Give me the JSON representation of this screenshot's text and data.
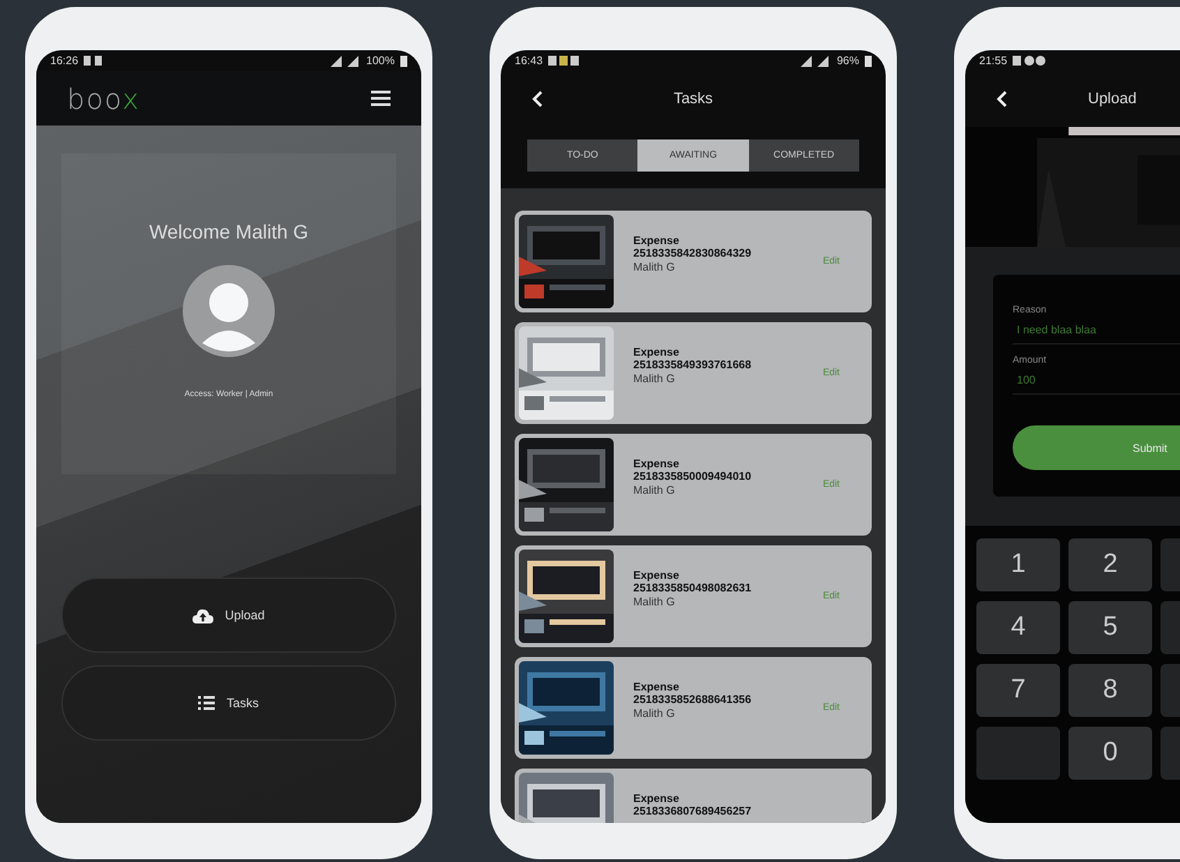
{
  "home": {
    "status_bar": {
      "time": "16:26",
      "battery": "100%"
    },
    "logo": {
      "main": "boo",
      "accent": "x"
    },
    "welcome": "Welcome Malith G",
    "access": "Access: Worker | Admin",
    "buttons": [
      {
        "kind": "upload",
        "label": "Upload"
      },
      {
        "kind": "tasks",
        "label": "Tasks"
      }
    ]
  },
  "tasks": {
    "status_bar": {
      "time": "16:43",
      "battery": "96%"
    },
    "title": "Tasks",
    "tabs": [
      {
        "label": "TO-DO",
        "selected": false
      },
      {
        "label": "AWAITING",
        "selected": true
      },
      {
        "label": "COMPLETED",
        "selected": false
      }
    ],
    "items": [
      {
        "title": "Expense",
        "number": "2518335842830864329",
        "author": "Malith G",
        "action": "Edit"
      },
      {
        "title": "Expense",
        "number": "2518335849393761668",
        "author": "Malith G",
        "action": "Edit"
      },
      {
        "title": "Expense",
        "number": "2518335850009494010",
        "author": "Malith G",
        "action": "Edit"
      },
      {
        "title": "Expense",
        "number": "2518335850498082631",
        "author": "Malith G",
        "action": "Edit"
      },
      {
        "title": "Expense",
        "number": "2518335852688641356",
        "author": "Malith G",
        "action": "Edit"
      },
      {
        "title": "Expense",
        "number": "2518336807689456257"
      }
    ]
  },
  "upload": {
    "status_bar": {
      "time": "21:55"
    },
    "title": "Upload",
    "fields": [
      {
        "label": "Reason",
        "value": "I need blaa blaa"
      },
      {
        "label": "Amount",
        "value": "100"
      }
    ],
    "submit": "Submit",
    "keys": [
      {
        "kind": "digit",
        "label": "1"
      },
      {
        "kind": "digit",
        "label": "2"
      },
      {
        "kind": "blank"
      },
      {
        "kind": "digit",
        "label": "4"
      },
      {
        "kind": "digit",
        "label": "5"
      },
      {
        "kind": "blank"
      },
      {
        "kind": "digit",
        "label": "7"
      },
      {
        "kind": "digit",
        "label": "8"
      },
      {
        "kind": "blank"
      },
      {
        "kind": "blank"
      },
      {
        "kind": "digit",
        "label": "0"
      },
      {
        "kind": "blank"
      }
    ]
  }
}
